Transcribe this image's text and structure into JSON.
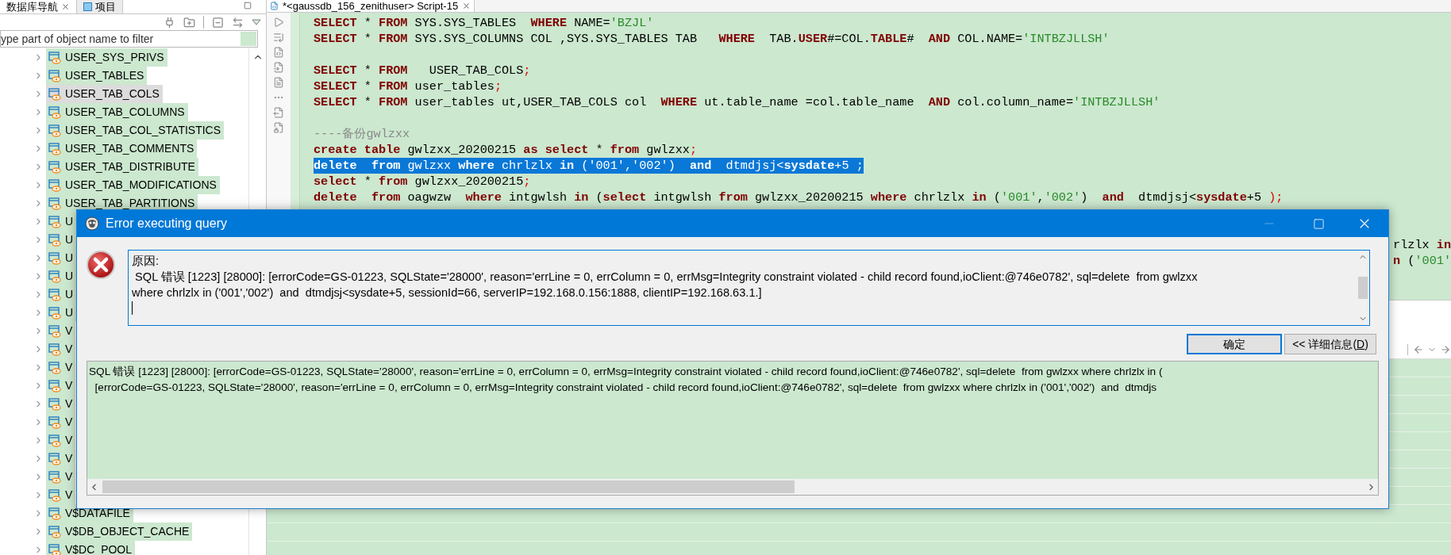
{
  "navigator": {
    "tabs": [
      {
        "label": "数据库导航",
        "selected": true
      },
      {
        "label": "项目",
        "selected": false
      }
    ],
    "filter": {
      "placeholder": "ype part of object name to filter"
    },
    "items": [
      {
        "label": "USER_SYS_PRIVS",
        "selected": false
      },
      {
        "label": "USER_TABLES",
        "selected": false
      },
      {
        "label": "USER_TAB_COLS",
        "selected": true
      },
      {
        "label": "USER_TAB_COLUMNS",
        "selected": false
      },
      {
        "label": "USER_TAB_COL_STATISTICS",
        "selected": false
      },
      {
        "label": "USER_TAB_COMMENTS",
        "selected": false
      },
      {
        "label": "USER_TAB_DISTRIBUTE",
        "selected": false
      },
      {
        "label": "USER_TAB_MODIFICATIONS",
        "selected": false
      },
      {
        "label": "USER_TAB_PARTITIONS",
        "selected": false
      },
      {
        "label": "U",
        "selected": false
      },
      {
        "label": "U",
        "selected": false
      },
      {
        "label": "U",
        "selected": false
      },
      {
        "label": "U",
        "selected": false
      },
      {
        "label": "U",
        "selected": false
      },
      {
        "label": "U",
        "selected": false
      },
      {
        "label": "V",
        "selected": false
      },
      {
        "label": "V",
        "selected": false
      },
      {
        "label": "V",
        "selected": false
      },
      {
        "label": "V",
        "selected": false
      },
      {
        "label": "V",
        "selected": false
      },
      {
        "label": "V",
        "selected": false
      },
      {
        "label": "V",
        "selected": false
      },
      {
        "label": "V",
        "selected": false
      },
      {
        "label": "V",
        "selected": false
      },
      {
        "label": "V",
        "selected": false
      },
      {
        "label": "V$DATAFILE",
        "selected": false
      },
      {
        "label": "V$DB_OBJECT_CACHE",
        "selected": false
      },
      {
        "label": "V$DC_POOL",
        "selected": false
      }
    ]
  },
  "editor": {
    "tab": {
      "title": "*<gaussdb_156_zenithuser> Script-15"
    },
    "lines": [
      {
        "kind": "code",
        "selected": false,
        "segments": [
          {
            "kind": "keyword",
            "text": "SELECT"
          },
          {
            "kind": "plain",
            "text": " * "
          },
          {
            "kind": "keyword",
            "text": "FROM"
          },
          {
            "kind": "plain",
            "text": " SYS.SYS_TABLES  "
          },
          {
            "kind": "keyword",
            "text": "WHERE"
          },
          {
            "kind": "plain",
            "text": " NAME="
          },
          {
            "kind": "string",
            "text": "'BZJL'"
          }
        ]
      },
      {
        "kind": "code",
        "selected": false,
        "segments": [
          {
            "kind": "keyword",
            "text": "SELECT"
          },
          {
            "kind": "plain",
            "text": " * "
          },
          {
            "kind": "keyword",
            "text": "FROM"
          },
          {
            "kind": "plain",
            "text": " SYS.SYS_COLUMNS COL ,SYS.SYS_TABLES TAB   "
          },
          {
            "kind": "keyword",
            "text": "WHERE"
          },
          {
            "kind": "plain",
            "text": "  TAB."
          },
          {
            "kind": "keyword",
            "text": "USER"
          },
          {
            "kind": "plain",
            "text": "#=COL."
          },
          {
            "kind": "keyword",
            "text": "TABLE"
          },
          {
            "kind": "plain",
            "text": "#  "
          },
          {
            "kind": "keyword",
            "text": "AND"
          },
          {
            "kind": "plain",
            "text": " COL.NAME="
          },
          {
            "kind": "string",
            "text": "'INTBZJLLSH'"
          }
        ]
      },
      {
        "kind": "blank"
      },
      {
        "kind": "code",
        "selected": false,
        "segments": [
          {
            "kind": "keyword",
            "text": "SELECT"
          },
          {
            "kind": "plain",
            "text": " * "
          },
          {
            "kind": "keyword",
            "text": "FROM"
          },
          {
            "kind": "plain",
            "text": "   USER_TAB_COLS"
          },
          {
            "kind": "punct",
            "text": ";"
          }
        ]
      },
      {
        "kind": "code",
        "selected": false,
        "segments": [
          {
            "kind": "keyword",
            "text": "SELECT"
          },
          {
            "kind": "plain",
            "text": " * "
          },
          {
            "kind": "keyword",
            "text": "FROM"
          },
          {
            "kind": "plain",
            "text": " user_tables"
          },
          {
            "kind": "punct",
            "text": ";"
          }
        ]
      },
      {
        "kind": "code",
        "selected": false,
        "segments": [
          {
            "kind": "keyword",
            "text": "SELECT"
          },
          {
            "kind": "plain",
            "text": " * "
          },
          {
            "kind": "keyword",
            "text": "FROM"
          },
          {
            "kind": "plain",
            "text": " user_tables ut,USER_TAB_COLS col  "
          },
          {
            "kind": "keyword",
            "text": "WHERE"
          },
          {
            "kind": "plain",
            "text": " ut.table_name =col.table_name  "
          },
          {
            "kind": "keyword",
            "text": "AND"
          },
          {
            "kind": "plain",
            "text": " col.column_name="
          },
          {
            "kind": "string",
            "text": "'INTBZJLLSH'"
          }
        ]
      },
      {
        "kind": "blank"
      },
      {
        "kind": "code",
        "selected": false,
        "segments": [
          {
            "kind": "comment",
            "text": "----备份gwlzxx"
          }
        ]
      },
      {
        "kind": "code",
        "selected": false,
        "segments": [
          {
            "kind": "keyword",
            "text": "create table"
          },
          {
            "kind": "plain",
            "text": " gwlzxx_20200215 "
          },
          {
            "kind": "keyword",
            "text": "as select"
          },
          {
            "kind": "plain",
            "text": " * "
          },
          {
            "kind": "keyword",
            "text": "from"
          },
          {
            "kind": "plain",
            "text": " gwlzxx"
          },
          {
            "kind": "punct",
            "text": ";"
          }
        ]
      },
      {
        "kind": "code",
        "selected": true,
        "segments": [
          {
            "kind": "keyword",
            "text": "delete  from"
          },
          {
            "kind": "plain",
            "text": " gwlzxx "
          },
          {
            "kind": "keyword",
            "text": "where"
          },
          {
            "kind": "plain",
            "text": " chrlzlx "
          },
          {
            "kind": "keyword",
            "text": "in"
          },
          {
            "kind": "plain",
            "text": " ("
          },
          {
            "kind": "string",
            "text": "'001'"
          },
          {
            "kind": "plain",
            "text": ","
          },
          {
            "kind": "string",
            "text": "'002'"
          },
          {
            "kind": "plain",
            "text": ")  "
          },
          {
            "kind": "keyword",
            "text": "and"
          },
          {
            "kind": "plain",
            "text": "  dtmdjsj<"
          },
          {
            "kind": "keyword",
            "text": "sysdate"
          },
          {
            "kind": "plain",
            "text": "+5 ;"
          }
        ]
      },
      {
        "kind": "code",
        "selected": false,
        "segments": [
          {
            "kind": "keyword",
            "text": "select"
          },
          {
            "kind": "plain",
            "text": " * "
          },
          {
            "kind": "keyword",
            "text": "from"
          },
          {
            "kind": "plain",
            "text": " gwlzxx_20200215"
          },
          {
            "kind": "punct",
            "text": ";"
          }
        ]
      },
      {
        "kind": "code",
        "selected": false,
        "segments": [
          {
            "kind": "keyword",
            "text": "delete  from"
          },
          {
            "kind": "plain",
            "text": " oagwzw  "
          },
          {
            "kind": "keyword",
            "text": "where"
          },
          {
            "kind": "plain",
            "text": " intgwlsh "
          },
          {
            "kind": "keyword",
            "text": "in"
          },
          {
            "kind": "plain",
            "text": " ("
          },
          {
            "kind": "keyword",
            "text": "select"
          },
          {
            "kind": "plain",
            "text": " intgwlsh "
          },
          {
            "kind": "keyword",
            "text": "from"
          },
          {
            "kind": "plain",
            "text": " gwlzxx_20200215 "
          },
          {
            "kind": "keyword",
            "text": "where"
          },
          {
            "kind": "plain",
            "text": " chrlzlx "
          },
          {
            "kind": "keyword",
            "text": "in"
          },
          {
            "kind": "plain",
            "text": " ("
          },
          {
            "kind": "string",
            "text": "'001'"
          },
          {
            "kind": "plain",
            "text": ","
          },
          {
            "kind": "string",
            "text": "'002'"
          },
          {
            "kind": "plain",
            "text": ")  "
          },
          {
            "kind": "keyword",
            "text": "and"
          },
          {
            "kind": "plain",
            "text": "  dtmdjsj<"
          },
          {
            "kind": "keyword",
            "text": "sysdate"
          },
          {
            "kind": "plain",
            "text": "+5 "
          },
          {
            "kind": "punct",
            "text": ");"
          }
        ]
      },
      {
        "kind": "blank"
      },
      {
        "kind": "blank"
      },
      {
        "kind": "fragment",
        "segments": [
          {
            "kind": "plain",
            "text": "rlzlx "
          },
          {
            "kind": "keyword",
            "text": "in"
          }
        ]
      },
      {
        "kind": "fragment",
        "segments": [
          {
            "kind": "keyword",
            "text": "n"
          },
          {
            "kind": "plain",
            "text": " ("
          },
          {
            "kind": "string",
            "text": "'001'"
          }
        ]
      }
    ]
  },
  "dialog": {
    "title": "Error executing query",
    "message_lines": [
      "原因:",
      " SQL 错误 [1223] [28000]: [errorCode=GS-01223, SQLState='28000', reason='errLine = 0, errColumn = 0, errMsg=Integrity constraint violated - child record found,ioClient:@746e0782', sql=delete  from gwlzxx",
      "where chrlzlx in ('001','002')  and  dtmdjsj<sysdate+5, sessionId=66, serverIP=192.168.0.156:1888, clientIP=192.168.63.1.]"
    ],
    "buttons": [
      {
        "kind": "default",
        "label": "确定"
      },
      {
        "kind": "details",
        "label": "<< 详细信息(",
        "mnemonic": "D",
        "label_end": ")"
      }
    ],
    "detail_lines": [
      "SQL 错误 [1223] [28000]: [errorCode=GS-01223, SQLState='28000', reason='errLine = 0, errColumn = 0, errMsg=Integrity constraint violated - child record found,ioClient:@746e0782', sql=delete  from gwlzxx where chrlzlx in (",
      "  [errorCode=GS-01223, SQLState='28000', reason='errLine = 0, errColumn = 0, errMsg=Integrity constraint violated - child record found,ioClient:@746e0782', sql=delete  from gwlzxx where chrlzlx in ('001','002')  and  dtmdjs"
    ]
  }
}
